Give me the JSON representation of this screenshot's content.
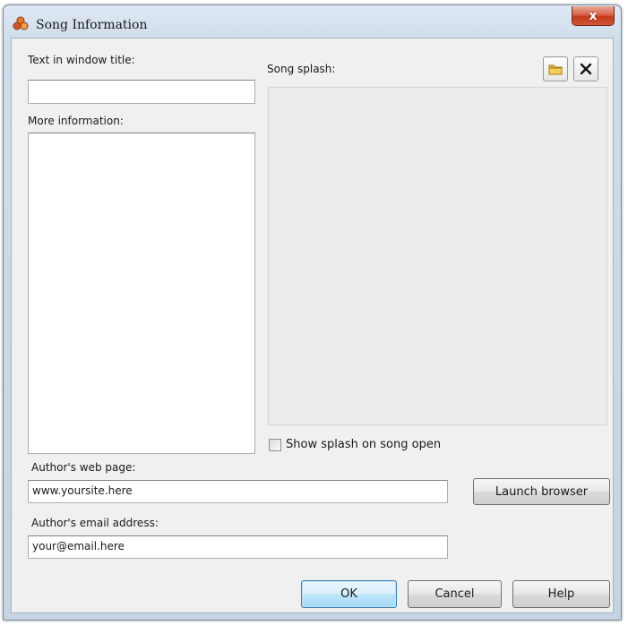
{
  "window": {
    "title": "Song Information",
    "close_label": "x"
  },
  "form": {
    "title_label": "Text in window title:",
    "title_value": "",
    "more_info_label": "More information:",
    "more_info_value": "",
    "splash_label": "Song splash:",
    "show_splash_label": "Show splash on song open",
    "show_splash_checked": false,
    "web_label": "Author's web page:",
    "web_value": "www.yoursite.here",
    "launch_label": "Launch browser",
    "email_label": "Author's email address:",
    "email_value": "your@email.here"
  },
  "buttons": {
    "ok": "OK",
    "cancel": "Cancel",
    "help": "Help"
  },
  "icons": {
    "app": "triple-ring-icon",
    "open_splash": "folder-icon",
    "clear_splash": "remove-x-icon"
  },
  "colors": {
    "title_bar": "#cfdceb",
    "client_bg": "#f0f0f0",
    "close_button": "#c23a1c",
    "default_button": "#bee6fd",
    "folder_icon": "#e5b53a"
  }
}
